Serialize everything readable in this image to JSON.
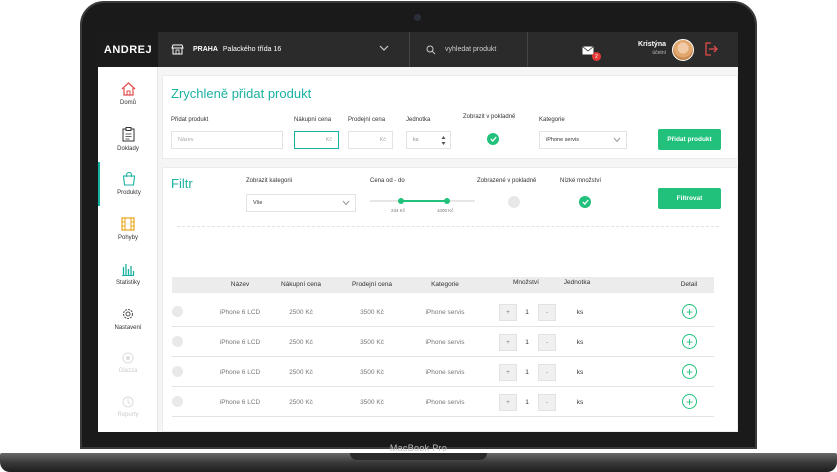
{
  "device": {
    "label": "MacBook Pro"
  },
  "topbar": {
    "brand": "ANDREJ",
    "store_city": "PRAHA",
    "store_address": "Palackého třída 16",
    "search_placeholder": "vyhledat produkt",
    "mail_badge": "2",
    "user_name": "Kristýna",
    "user_role": "účetní"
  },
  "sidebar": {
    "items": [
      {
        "label": "Domů",
        "icon": "home-icon"
      },
      {
        "label": "Doklady",
        "icon": "clipboard-icon"
      },
      {
        "label": "Produkty",
        "icon": "bag-icon"
      },
      {
        "label": "Pohyby",
        "icon": "film-icon"
      },
      {
        "label": "Statistiky",
        "icon": "bar-chart-icon"
      },
      {
        "label": "Nastavení",
        "icon": "gear-icon"
      },
      {
        "label": "Glazza",
        "icon": "glazza-icon"
      },
      {
        "label": "Reporty",
        "icon": "reports-icon"
      }
    ]
  },
  "quick_add": {
    "title": "Zrychleně přidat produkt",
    "add_label": "Přidat produkt",
    "name_placeholder": "Název",
    "buy_price_label": "Nákupní cena",
    "buy_price_value": "Kč",
    "sell_price_label": "Prodejní cena",
    "sell_price_value": "Kč",
    "unit_label": "Jednotka",
    "unit_value": "ks",
    "show_register_label": "Zobrazit v pokladně",
    "category_label": "Kategorie",
    "category_value": "iPhone servis",
    "submit_label": "Přidat produkt"
  },
  "filter": {
    "title": "Filtr",
    "category_label": "Zobrazit kategorii",
    "category_value": "Vše",
    "price_label": "Cena od - do",
    "price_min": "234 Kč",
    "price_max": "1000 Kč",
    "shown_register_label": "Zobrazené v pokladně",
    "low_qty_label": "Nízké množství",
    "submit_label": "Filtrovat"
  },
  "table": {
    "headers": [
      "Název",
      "Nákupní cena",
      "Prodejní cena",
      "Kategorie",
      "Množství",
      "Jednotka",
      "Detail"
    ],
    "rows": [
      {
        "name": "iPhone 6 LCD",
        "buy": "2500 Kč",
        "sell": "3500 Kč",
        "category": "iPhone servis",
        "qty": "1",
        "unit": "ks"
      },
      {
        "name": "iPhone 6 LCD",
        "buy": "2500 Kč",
        "sell": "3500 Kč",
        "category": "iPhone servis",
        "qty": "1",
        "unit": "ks"
      },
      {
        "name": "iPhone 6 LCD",
        "buy": "2500 Kč",
        "sell": "3500 Kč",
        "category": "iPhone servis",
        "qty": "1",
        "unit": "ks"
      },
      {
        "name": "iPhone 6 LCD",
        "buy": "2500 Kč",
        "sell": "3500 Kč",
        "category": "iPhone servis",
        "qty": "1",
        "unit": "ks"
      }
    ],
    "plus_label": "+",
    "minus_label": "-"
  },
  "colors": {
    "accent": "#19b1a0",
    "button": "#21c17b",
    "topbar": "#2b2b2b"
  }
}
